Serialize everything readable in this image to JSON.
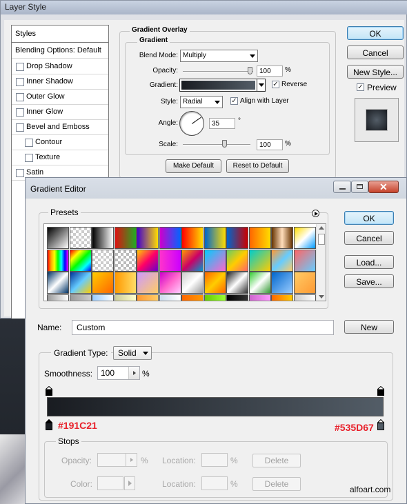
{
  "layer_style": {
    "title": "Layer Style",
    "styles_header": "Styles",
    "blending_options": "Blending Options: Default",
    "items": [
      {
        "label": "Drop Shadow",
        "checked": false
      },
      {
        "label": "Inner Shadow",
        "checked": false
      },
      {
        "label": "Outer Glow",
        "checked": false
      },
      {
        "label": "Inner Glow",
        "checked": false
      },
      {
        "label": "Bevel and Emboss",
        "checked": false
      },
      {
        "label": "Contour",
        "checked": false
      },
      {
        "label": "Texture",
        "checked": false
      },
      {
        "label": "Satin",
        "checked": false
      }
    ],
    "section_title": "Gradient Overlay",
    "sub_title": "Gradient",
    "blend_mode_label": "Blend Mode:",
    "blend_mode_value": "Multiply",
    "opacity_label": "Opacity:",
    "opacity_value": "100",
    "percent": "%",
    "gradient_label": "Gradient:",
    "reverse_label": "Reverse",
    "reverse_checked": true,
    "style_label": "Style:",
    "style_value": "Radial",
    "align_label": "Align with Layer",
    "align_checked": true,
    "angle_label": "Angle:",
    "angle_value": "35",
    "degree": "°",
    "scale_label": "Scale:",
    "scale_value": "100",
    "make_default": "Make Default",
    "reset_default": "Reset to Default",
    "ok": "OK",
    "cancel": "Cancel",
    "new_style": "New Style...",
    "preview_label": "Preview",
    "preview_checked": true
  },
  "gradient_editor": {
    "title": "Gradient Editor",
    "presets_label": "Presets",
    "ok": "OK",
    "cancel": "Cancel",
    "load": "Load...",
    "save": "Save...",
    "name_label": "Name:",
    "name_value": "Custom",
    "new_button": "New",
    "gradient_type_label": "Gradient Type:",
    "gradient_type_value": "Solid",
    "smoothness_label": "Smoothness:",
    "smoothness_value": "100",
    "percent": "%",
    "left_color": "#191C21",
    "right_color": "#535D67",
    "stops_label": "Stops",
    "opacity_label": "Opacity:",
    "location_label": "Location:",
    "color_label": "Color:",
    "delete_label": "Delete",
    "watermark": "alfoart.com"
  },
  "colors": {
    "stop_start": "#191C21",
    "stop_end": "#535D67",
    "label_red": "#e8202a"
  }
}
